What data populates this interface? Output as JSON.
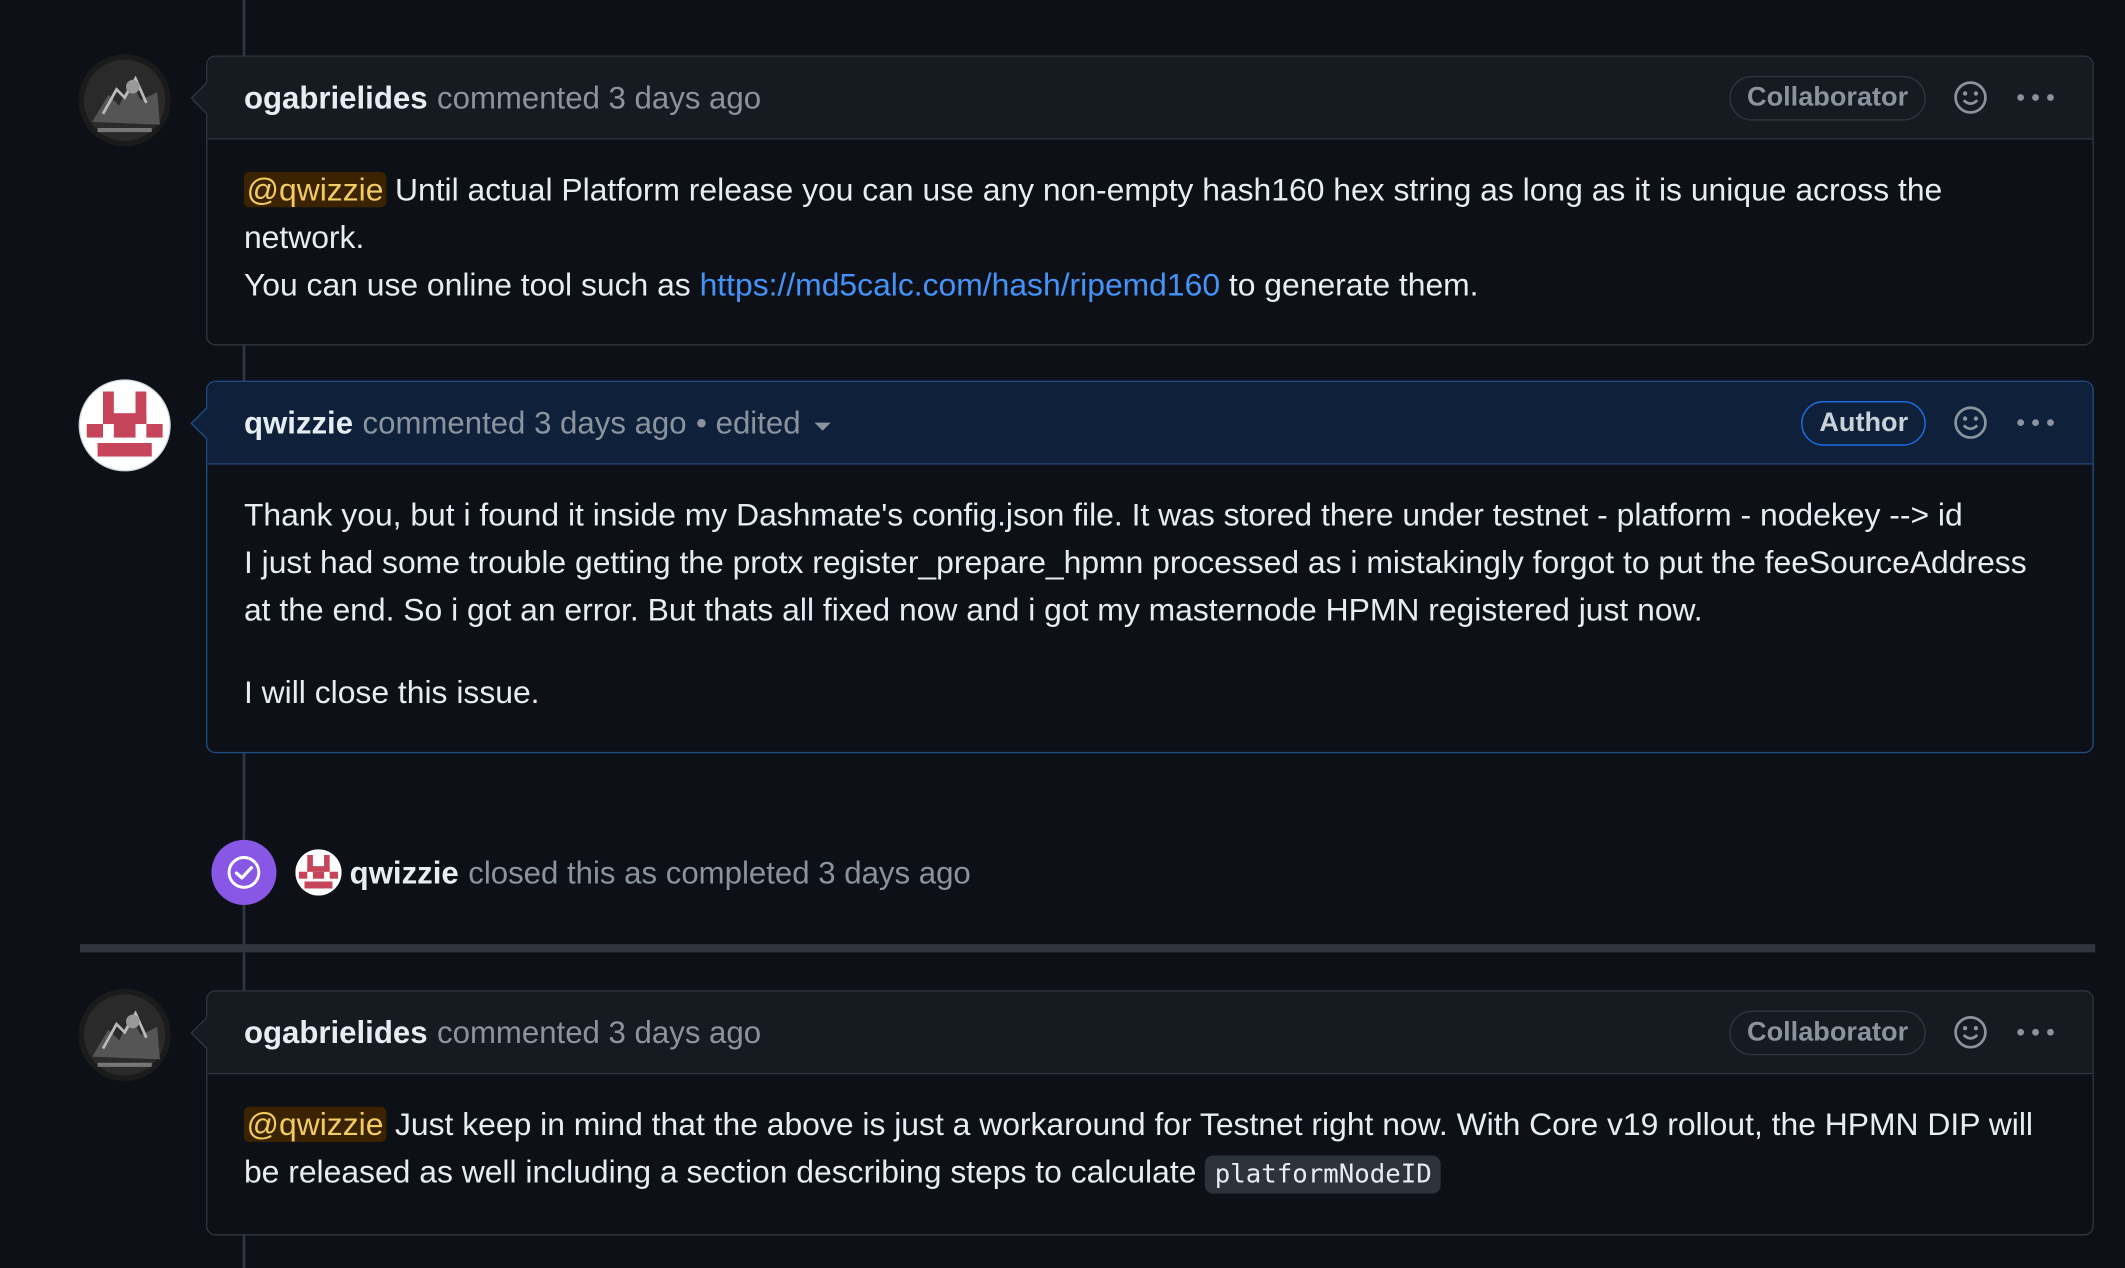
{
  "comments": [
    {
      "username": "ogabrielides",
      "action": "commented",
      "time": "3 days ago",
      "role": "Collaborator",
      "mention": "@qwizzie",
      "line1": "Until actual Platform release you can use any non-empty hash160 hex string as long as it is unique across the network.",
      "line2_prefix": "You can use online tool such as",
      "link_text": "https://md5calc.com/hash/ripemd160",
      "line2_suffix": "to generate them."
    },
    {
      "username": "qwizzie",
      "action": "commented",
      "time": "3 days ago",
      "edited": "• edited",
      "role": "Author",
      "para1": "Thank you, but i found it inside my Dashmate's config.json file. It was stored there under testnet - platform - nodekey --> id",
      "para1b": "I just had some trouble getting the protx register_prepare_hpmn processed as i mistakingly forgot to put the feeSourceAddress at the end. So i got an error. But thats all fixed now and i got my masternode HPMN registered just now.",
      "para2": "I will close this issue."
    },
    {
      "username": "ogabrielides",
      "action": "commented",
      "time": "3 days ago",
      "role": "Collaborator",
      "mention": "@qwizzie",
      "text": "Just keep in mind that the above is just a workaround for Testnet right now. With Core v19 rollout, the HPMN DIP will be released as well including a section describing steps to calculate",
      "code": "platformNodeID"
    }
  ],
  "event": {
    "username": "qwizzie",
    "text": "closed this as completed 3 days ago"
  },
  "colors": {
    "background": "#0d1117",
    "closed_badge": "#8957e5",
    "link": "#4493f8",
    "mention_bg": "#3b2300"
  }
}
